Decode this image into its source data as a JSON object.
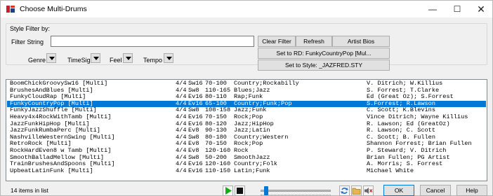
{
  "window": {
    "title": "Choose Multi-Drums",
    "minimize": "—",
    "maximize": "☐",
    "close": "✕"
  },
  "filter": {
    "group_title": "Style Filter by:",
    "string_label": "Filter String",
    "string_value": "",
    "genre_label": "Genre",
    "timesig_label": "TimeSig",
    "feel_label": "Feel",
    "tempo_label": "Tempo"
  },
  "buttons": {
    "clear_filter": "Clear Filter",
    "refresh": "Refresh",
    "artist_bios": "Artist Bios",
    "set_rd": "Set to RD: FunkyCountryPop [Mul...",
    "set_style": "Set to Style: _JAZFRED.STY",
    "ok": "OK",
    "cancel": "Cancel",
    "help": "Help"
  },
  "list": {
    "selected_index": 3,
    "rows": [
      {
        "name": "BoomChickGroovySw16 [Multi]",
        "sig": "4/4",
        "feel": "Sw16",
        "tempo": "70-100",
        "genre": "Country;Rockabilly",
        "artist": "V. Ditrich; W.Killius"
      },
      {
        "name": "BrushesAndBlues [Multi]",
        "sig": "4/4",
        "feel": "Sw8",
        "tempo": "110-165",
        "genre": "Blues;Jazz",
        "artist": "S. Forrest; T.Clarke"
      },
      {
        "name": "FunkyCloudRap [Multi]",
        "sig": "4/4",
        "feel": "Ev16",
        "tempo": "80-110",
        "genre": "Rap;Funk",
        "artist": "Ed (Great Oz); S.Forrest"
      },
      {
        "name": "FunkyCountryPop [Multi]",
        "sig": "4/4",
        "feel": "Ev16",
        "tempo": "65-100",
        "genre": "Country;Funk;Pop",
        "artist": "S.Forrest; R.Lawson"
      },
      {
        "name": "FunkyJazzShuffle [Multi]",
        "sig": "4/4",
        "feel": "Sw8",
        "tempo": "108-158",
        "genre": "Jazz;Funk",
        "artist": "C. Scott; K.Blevins"
      },
      {
        "name": "Heavy4x4RockWithTamb [Multi]",
        "sig": "4/4",
        "feel": "Ev16",
        "tempo": "70-150",
        "genre": "Rock;Pop",
        "artist": "Vince Ditrich; Wayne Killius"
      },
      {
        "name": "JazzFunkHipHop [Multi]",
        "sig": "4/4",
        "feel": "Ev16",
        "tempo": "80-120",
        "genre": "Jazz;HipHop",
        "artist": "R. Lawson; Ed (GreatOz)"
      },
      {
        "name": "JazzFunkRumbaPerc [Multi]",
        "sig": "4/4",
        "feel": "Ev8",
        "tempo": "90-130",
        "genre": "Jazz;Latin",
        "artist": "R. Lawson; C. Scott"
      },
      {
        "name": "NashvilleWesternSwing [Multi]",
        "sig": "4/4",
        "feel": "Sw8",
        "tempo": "80-180",
        "genre": "Country;Western",
        "artist": "C. Scott; B. Fullen"
      },
      {
        "name": "RetroRock [Multi]",
        "sig": "4/4",
        "feel": "Ev8",
        "tempo": "70-150",
        "genre": "Rock;Pop",
        "artist": "Shannon Forrest; Brian Fullen"
      },
      {
        "name": "RockHardEven8 w Tamb [Multi]",
        "sig": "4/4",
        "feel": "Ev8",
        "tempo": "120-160",
        "genre": "Rock",
        "artist": "P. Steward; V. Ditrich"
      },
      {
        "name": "SmoothBalladMellow [Multi]",
        "sig": "4/4",
        "feel": "Sw8",
        "tempo": "50-200",
        "genre": "SmoothJazz",
        "artist": "Brian Fullen; PG Artist"
      },
      {
        "name": "TrainBrushesAndSpoons [Multi]",
        "sig": "4/4",
        "feel": "Ev16",
        "tempo": "120-160",
        "genre": "Country;Folk",
        "artist": "A. Morris; S. Forrest"
      },
      {
        "name": "UpbeatLatinFunk [Multi]",
        "sig": "4/4",
        "feel": "Ev16",
        "tempo": "110-150",
        "genre": "Latin;Funk",
        "artist": "Michael White"
      }
    ]
  },
  "status": {
    "count_text": "14 items in list"
  },
  "transport": {
    "play_icon": "play-icon",
    "stop_icon": "stop-icon",
    "volume_level_fraction": 0.08
  },
  "colors": {
    "selection": "#0078d7",
    "play_green": "#18a818"
  }
}
